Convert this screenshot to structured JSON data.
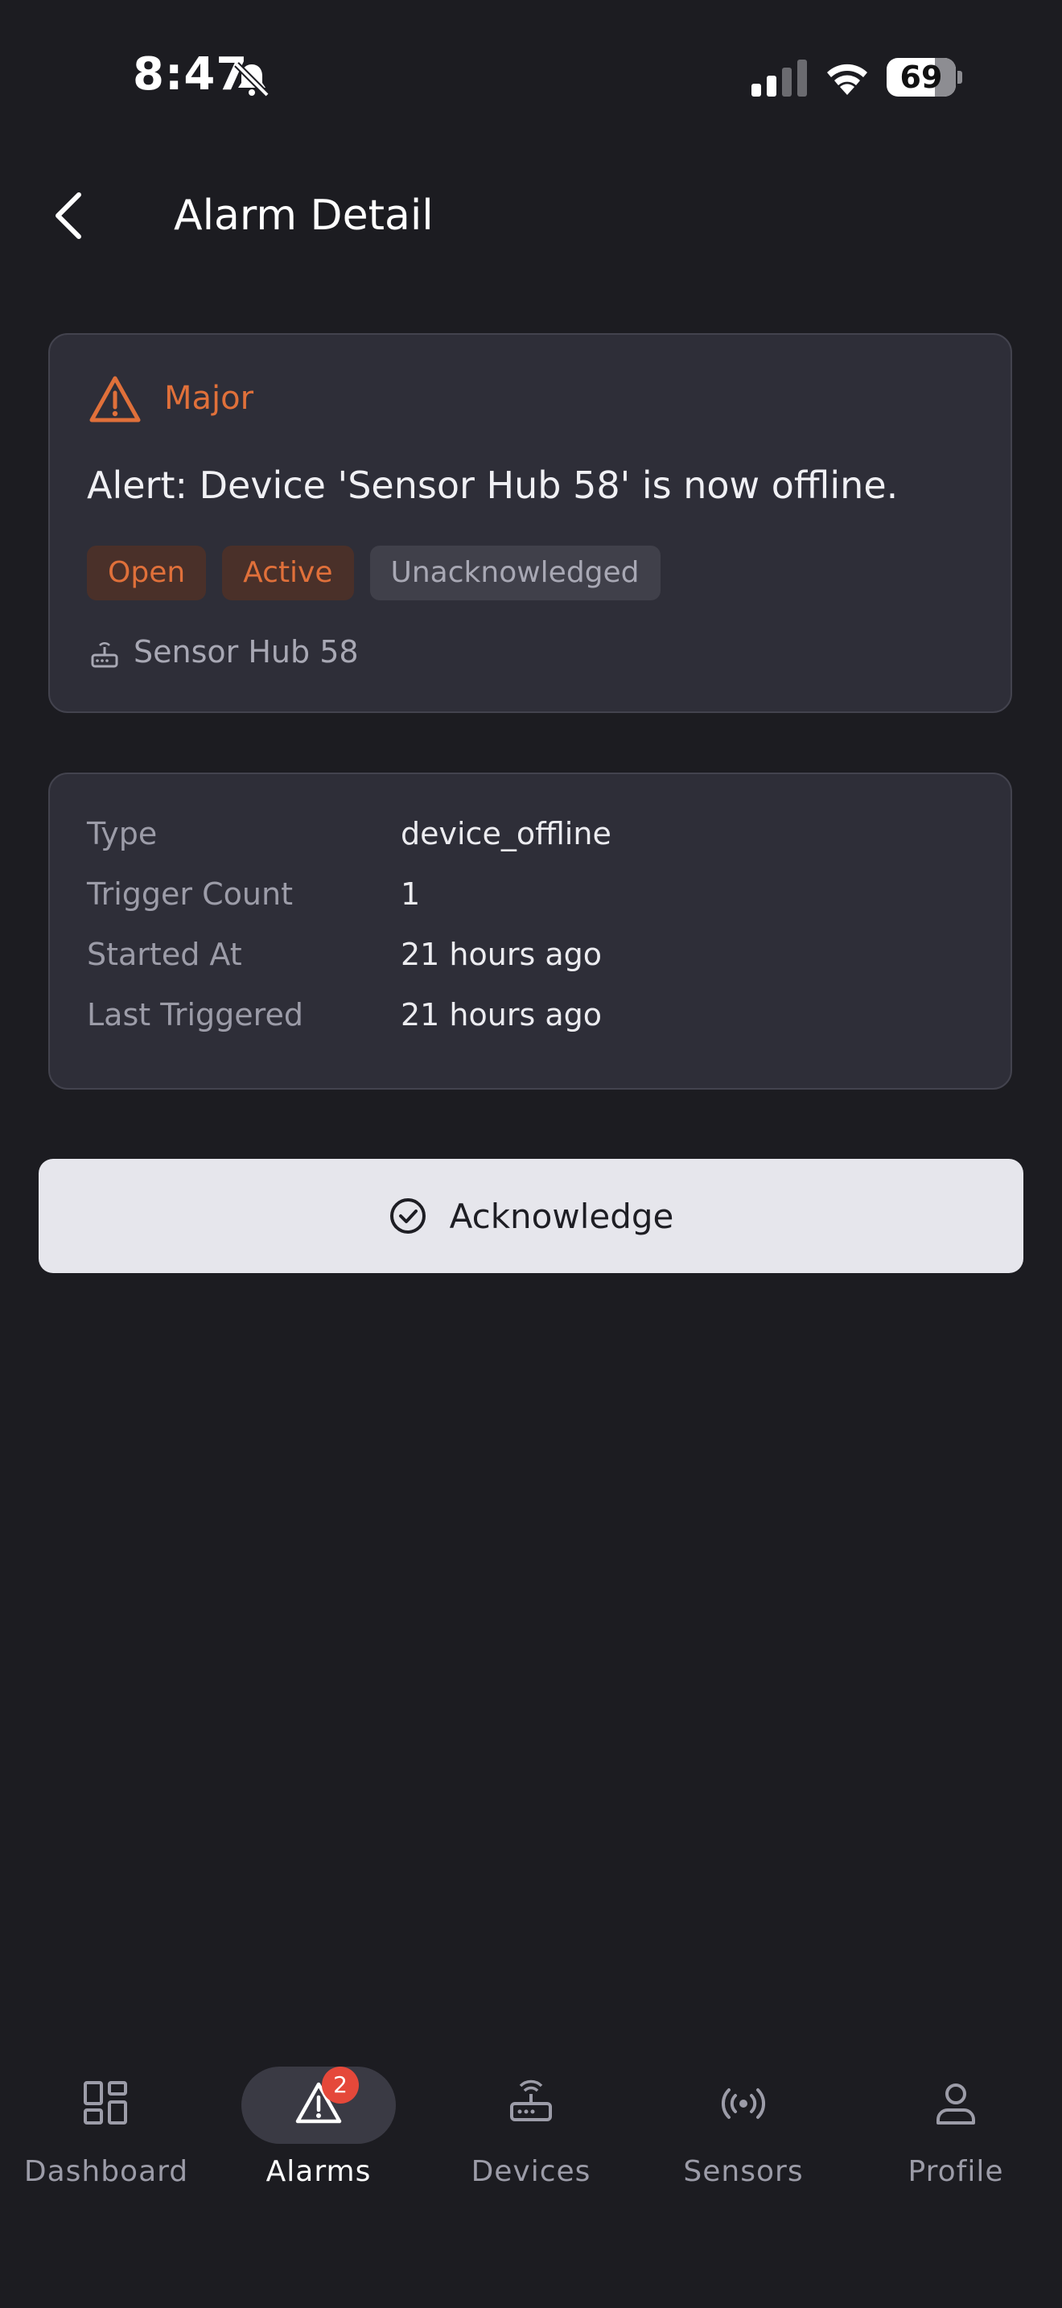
{
  "status_bar": {
    "time": "8:47",
    "battery": "69"
  },
  "header": {
    "title": "Alarm Detail"
  },
  "alarm": {
    "severity": "Major",
    "message": "Alert: Device 'Sensor Hub 58' is now offline.",
    "chips": {
      "status": "Open",
      "state": "Active",
      "ack": "Unacknowledged"
    },
    "device": "Sensor Hub 58"
  },
  "details": [
    {
      "label": "Type",
      "value": "device_offline"
    },
    {
      "label": "Trigger Count",
      "value": "1"
    },
    {
      "label": "Started At",
      "value": "21 hours ago"
    },
    {
      "label": "Last Triggered",
      "value": "21 hours ago"
    }
  ],
  "actions": {
    "acknowledge": "Acknowledge"
  },
  "nav": {
    "items": [
      {
        "label": "Dashboard",
        "icon": "dashboard-icon"
      },
      {
        "label": "Alarms",
        "icon": "alarm-icon",
        "badge": "2"
      },
      {
        "label": "Devices",
        "icon": "router-icon"
      },
      {
        "label": "Sensors",
        "icon": "sensor-icon"
      },
      {
        "label": "Profile",
        "icon": "profile-icon"
      }
    ]
  },
  "colors": {
    "accent": "#e0703a",
    "background": "#1c1c21",
    "card": "#2e2e38",
    "badge": "#e5483a"
  }
}
